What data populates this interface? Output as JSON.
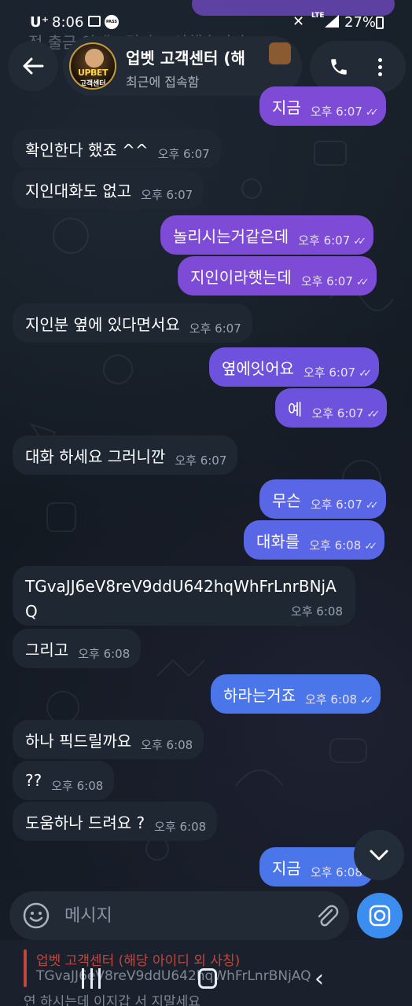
{
  "status_bar": {
    "carrier": "U⁺",
    "time": "8:06",
    "pass_label": "PASS",
    "network": "LTE",
    "battery": "27%"
  },
  "header": {
    "title": "업벳 고객센터 (해",
    "subtitle": "최근에 접속함",
    "avatar_brand": "UPBET",
    "avatar_sub": "고객센터"
  },
  "top_remnant": {
    "text": "정 출금 안내드린다고 안했습니다 ^^"
  },
  "messages": [
    {
      "dir": "out",
      "text": "지금",
      "time": "오후 6:07"
    },
    {
      "dir": "in",
      "text": "확인한다 했죠 ^^",
      "time": "오후 6:07"
    },
    {
      "dir": "in",
      "text": "지인대화도 없고",
      "time": "오후 6:07"
    },
    {
      "dir": "out",
      "text": "놀리시는거같은데",
      "time": "오후 6:07"
    },
    {
      "dir": "out",
      "text": "지인이라햇는데",
      "time": "오후 6:07"
    },
    {
      "dir": "in",
      "text": "지인분 옆에 있다면서요",
      "time": "오후 6:07"
    },
    {
      "dir": "out",
      "text": "옆에잇어요",
      "time": "오후 6:07"
    },
    {
      "dir": "out",
      "text": "예",
      "time": "오후 6:07"
    },
    {
      "dir": "in",
      "text": "대화 하세요 그러니깐",
      "time": "오후 6:07"
    },
    {
      "dir": "out",
      "text": "무슨",
      "time": "오후 6:07"
    },
    {
      "dir": "out",
      "text": "대화를",
      "time": "오후 6:08"
    },
    {
      "dir": "in",
      "text": "TGvaJJ6eV8reV9ddU642hqWhFrLnrBNjAQ",
      "time": "오후 6:08"
    },
    {
      "dir": "in",
      "text": "그리고",
      "time": "오후 6:08"
    },
    {
      "dir": "out",
      "text": "하라는거죠",
      "time": "오후 6:08"
    },
    {
      "dir": "in",
      "text": "하나 픽드릴까요",
      "time": "오후 6:08"
    },
    {
      "dir": "in",
      "text": "??",
      "time": "오후 6:08"
    },
    {
      "dir": "in",
      "text": "도움하나 드려요 ?",
      "time": "오후 6:08"
    },
    {
      "dir": "out",
      "text": "지금",
      "time": "오후 6:08"
    }
  ],
  "input": {
    "placeholder": "메시지"
  },
  "notification": {
    "title": "업벳 고객센터 (해당 아이디 외 사칭)",
    "body": "TGvaJJ6eV8reV9ddU642hqWhFrLnrBNjAQ",
    "next": "연 하시는데 이지갑 서 지말세요"
  },
  "colors": {
    "background": "#141a24",
    "incoming_bubble": "#1f2733",
    "outgoing_purple": "#7d4bd6",
    "outgoing_blue": "#4a76ea",
    "camera_button": "#3b8ef0"
  }
}
